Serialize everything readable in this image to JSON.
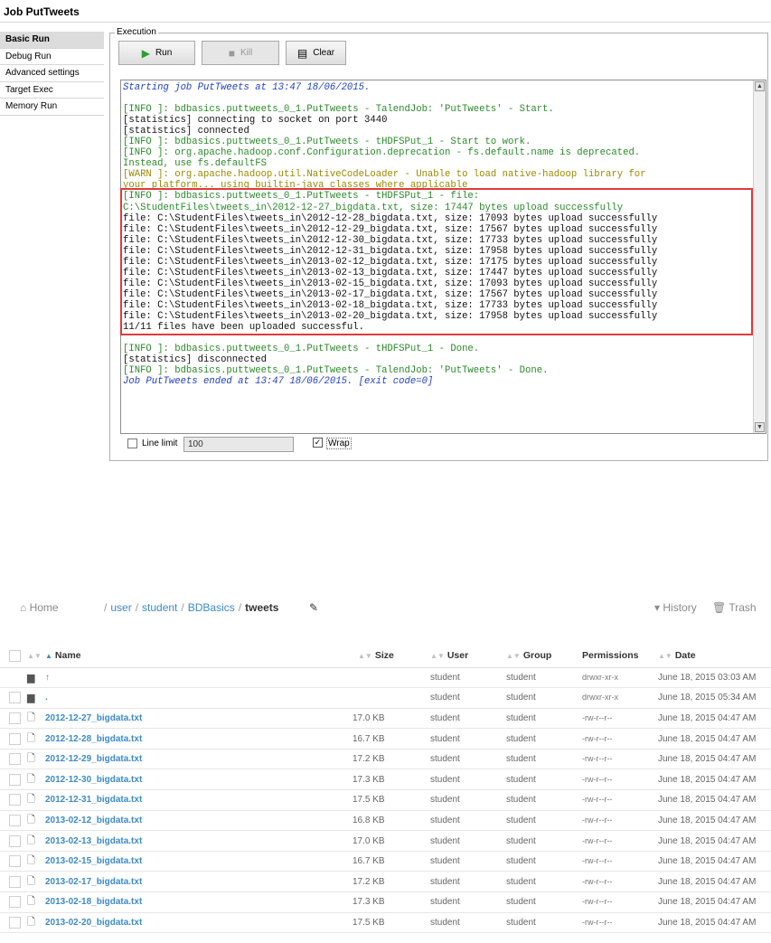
{
  "talend": {
    "job_title": "Job PutTweets",
    "side_nav": [
      "Basic Run",
      "Debug Run",
      "Advanced settings",
      "Target Exec",
      "Memory Run"
    ],
    "execution_label": "Execution",
    "buttons": {
      "run": "Run",
      "kill": "Kill",
      "clear": "Clear"
    },
    "console_lines": [
      {
        "text": "Starting job PutTweets at 13:47 18/06/2015.",
        "style": "blue"
      },
      {
        "text": "",
        "style": "black"
      },
      {
        "text": "[INFO ]: bdbasics.puttweets_0_1.PutTweets - TalendJob: 'PutTweets' - Start.",
        "style": "green"
      },
      {
        "text": "[statistics] connecting to socket on port 3440",
        "style": "black"
      },
      {
        "text": "[statistics] connected",
        "style": "black"
      },
      {
        "text": "[INFO ]: bdbasics.puttweets_0_1.PutTweets - tHDFSPut_1 - Start to work.",
        "style": "green"
      },
      {
        "text": "[INFO ]: org.apache.hadoop.conf.Configuration.deprecation - fs.default.name is deprecated.",
        "style": "green"
      },
      {
        "text": "Instead, use fs.defaultFS",
        "style": "green"
      },
      {
        "text": "[WARN ]: org.apache.hadoop.util.NativeCodeLoader - Unable to load native-hadoop library for",
        "style": "olive"
      },
      {
        "text": "your platform... using builtin-java classes where applicable",
        "style": "olive"
      },
      {
        "text": "[INFO ]: bdbasics.puttweets_0_1.PutTweets - tHDFSPut_1 - file:",
        "style": "green"
      },
      {
        "text": "C:\\StudentFiles\\tweets_in\\2012-12-27_bigdata.txt, size: 17447 bytes upload successfully",
        "style": "green"
      },
      {
        "text": "file: C:\\StudentFiles\\tweets_in\\2012-12-28_bigdata.txt, size: 17093 bytes upload successfully",
        "style": "black"
      },
      {
        "text": "file: C:\\StudentFiles\\tweets_in\\2012-12-29_bigdata.txt, size: 17567 bytes upload successfully",
        "style": "black"
      },
      {
        "text": "file: C:\\StudentFiles\\tweets_in\\2012-12-30_bigdata.txt, size: 17733 bytes upload successfully",
        "style": "black"
      },
      {
        "text": "file: C:\\StudentFiles\\tweets_in\\2012-12-31_bigdata.txt, size: 17958 bytes upload successfully",
        "style": "black"
      },
      {
        "text": "file: C:\\StudentFiles\\tweets_in\\2013-02-12_bigdata.txt, size: 17175 bytes upload successfully",
        "style": "black"
      },
      {
        "text": "file: C:\\StudentFiles\\tweets_in\\2013-02-13_bigdata.txt, size: 17447 bytes upload successfully",
        "style": "black"
      },
      {
        "text": "file: C:\\StudentFiles\\tweets_in\\2013-02-15_bigdata.txt, size: 17093 bytes upload successfully",
        "style": "black"
      },
      {
        "text": "file: C:\\StudentFiles\\tweets_in\\2013-02-17_bigdata.txt, size: 17567 bytes upload successfully",
        "style": "black"
      },
      {
        "text": "file: C:\\StudentFiles\\tweets_in\\2013-02-18_bigdata.txt, size: 17733 bytes upload successfully",
        "style": "black"
      },
      {
        "text": "file: C:\\StudentFiles\\tweets_in\\2013-02-20_bigdata.txt, size: 17958 bytes upload successfully",
        "style": "black"
      },
      {
        "text": "11/11 files have been uploaded successful.",
        "style": "black"
      },
      {
        "text": "",
        "style": "black"
      },
      {
        "text": "[INFO ]: bdbasics.puttweets_0_1.PutTweets - tHDFSPut_1 - Done.",
        "style": "green"
      },
      {
        "text": "[statistics] disconnected",
        "style": "black"
      },
      {
        "text": "[INFO ]: bdbasics.puttweets_0_1.PutTweets - TalendJob: 'PutTweets' - Done.",
        "style": "green"
      },
      {
        "text": "Job PutTweets ended at 13:47 18/06/2015. [exit code=0]",
        "style": "blue"
      }
    ],
    "line_limit_label": "Line limit",
    "line_limit_value": "100",
    "line_limit_checked": false,
    "wrap_label": "Wrap",
    "wrap_checked": true
  },
  "hue": {
    "home_label": "Home",
    "breadcrumb": [
      "user",
      "student",
      "BDBasics"
    ],
    "current_dir": "tweets",
    "history_label": "History",
    "trash_label": "Trash",
    "columns": {
      "name": "Name",
      "size": "Size",
      "user": "User",
      "group": "Group",
      "permissions": "Permissions",
      "date": "Date"
    },
    "rows": [
      {
        "icon": "folder",
        "name": "↑",
        "size": "",
        "user": "student",
        "group": "student",
        "perm": "drwxr-xr-x",
        "date": "June 18, 2015 03:03 AM",
        "checkbox": false
      },
      {
        "icon": "folder",
        "name": ".",
        "size": "",
        "user": "student",
        "group": "student",
        "perm": "drwxr-xr-x",
        "date": "June 18, 2015 05:34 AM",
        "checkbox": true
      },
      {
        "icon": "file",
        "name": "2012-12-27_bigdata.txt",
        "size": "17.0 KB",
        "user": "student",
        "group": "student",
        "perm": "-rw-r--r--",
        "date": "June 18, 2015 04:47 AM",
        "checkbox": true
      },
      {
        "icon": "file",
        "name": "2012-12-28_bigdata.txt",
        "size": "16.7 KB",
        "user": "student",
        "group": "student",
        "perm": "-rw-r--r--",
        "date": "June 18, 2015 04:47 AM",
        "checkbox": true
      },
      {
        "icon": "file",
        "name": "2012-12-29_bigdata.txt",
        "size": "17.2 KB",
        "user": "student",
        "group": "student",
        "perm": "-rw-r--r--",
        "date": "June 18, 2015 04:47 AM",
        "checkbox": true
      },
      {
        "icon": "file",
        "name": "2012-12-30_bigdata.txt",
        "size": "17.3 KB",
        "user": "student",
        "group": "student",
        "perm": "-rw-r--r--",
        "date": "June 18, 2015 04:47 AM",
        "checkbox": true
      },
      {
        "icon": "file",
        "name": "2012-12-31_bigdata.txt",
        "size": "17.5 KB",
        "user": "student",
        "group": "student",
        "perm": "-rw-r--r--",
        "date": "June 18, 2015 04:47 AM",
        "checkbox": true
      },
      {
        "icon": "file",
        "name": "2013-02-12_bigdata.txt",
        "size": "16.8 KB",
        "user": "student",
        "group": "student",
        "perm": "-rw-r--r--",
        "date": "June 18, 2015 04:47 AM",
        "checkbox": true
      },
      {
        "icon": "file",
        "name": "2013-02-13_bigdata.txt",
        "size": "17.0 KB",
        "user": "student",
        "group": "student",
        "perm": "-rw-r--r--",
        "date": "June 18, 2015 04:47 AM",
        "checkbox": true
      },
      {
        "icon": "file",
        "name": "2013-02-15_bigdata.txt",
        "size": "16.7 KB",
        "user": "student",
        "group": "student",
        "perm": "-rw-r--r--",
        "date": "June 18, 2015 04:47 AM",
        "checkbox": true
      },
      {
        "icon": "file",
        "name": "2013-02-17_bigdata.txt",
        "size": "17.2 KB",
        "user": "student",
        "group": "student",
        "perm": "-rw-r--r--",
        "date": "June 18, 2015 04:47 AM",
        "checkbox": true
      },
      {
        "icon": "file",
        "name": "2013-02-18_bigdata.txt",
        "size": "17.3 KB",
        "user": "student",
        "group": "student",
        "perm": "-rw-r--r--",
        "date": "June 18, 2015 04:47 AM",
        "checkbox": true
      },
      {
        "icon": "file",
        "name": "2013-02-20_bigdata.txt",
        "size": "17.5 KB",
        "user": "student",
        "group": "student",
        "perm": "-rw-r--r--",
        "date": "June 18, 2015 04:47 AM",
        "checkbox": true
      }
    ]
  }
}
